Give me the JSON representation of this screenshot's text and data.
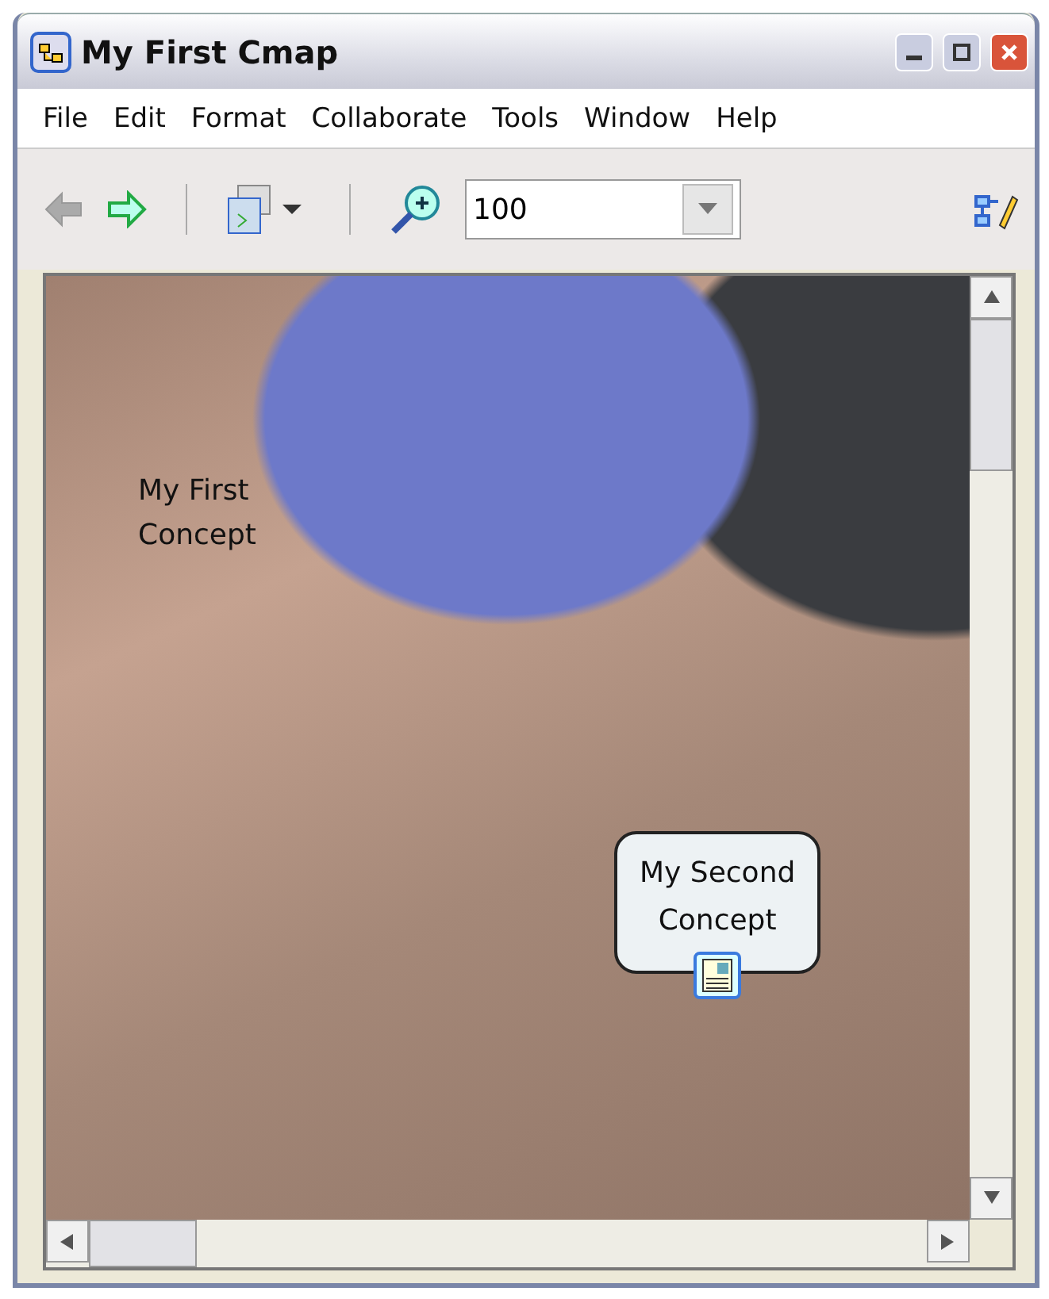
{
  "window": {
    "title": "My First Cmap"
  },
  "menu": [
    {
      "label": "File"
    },
    {
      "label": "Edit"
    },
    {
      "label": "Format"
    },
    {
      "label": "Collaborate"
    },
    {
      "label": "Tools"
    },
    {
      "label": "Window"
    },
    {
      "label": "Help"
    }
  ],
  "toolbar": {
    "back": {
      "disabled": true
    },
    "forward": {
      "disabled": false
    },
    "zoom": {
      "value": "100"
    }
  },
  "concepts": [
    {
      "kind": "plain",
      "lines": [
        "My First",
        "Concept"
      ],
      "has_resource": false
    },
    {
      "kind": "box",
      "lines": [
        "My Second",
        "Concept"
      ],
      "has_resource": true
    }
  ]
}
